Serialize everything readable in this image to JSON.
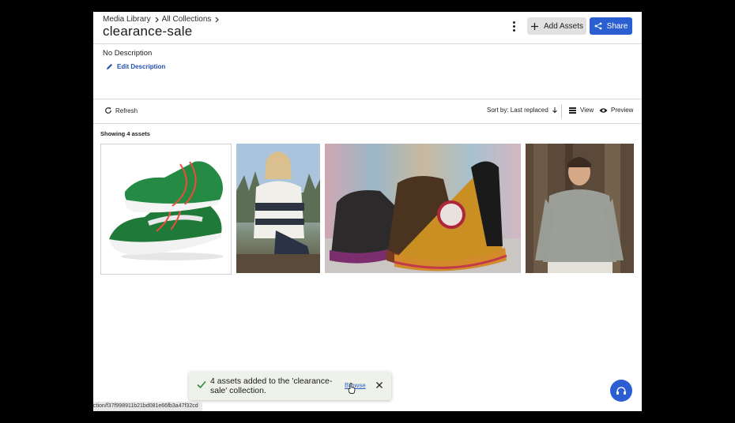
{
  "breadcrumb": [
    {
      "label": "Media Library"
    },
    {
      "label": "All Collections"
    }
  ],
  "collection": {
    "title": "clearance-sale",
    "description": "No Description",
    "edit_description_label": "Edit Description"
  },
  "header": {
    "more_icon": "more-vertical-icon",
    "add_assets_label": "Add Assets",
    "share_label": "Share"
  },
  "toolbar": {
    "refresh_label": "Refresh",
    "sort_label": "Sort by: Last replaced",
    "view_label": "View",
    "preview_label": "Preview"
  },
  "assets": {
    "showing_label": "Showing 4 assets",
    "items": [
      {
        "kind": "sneaker"
      },
      {
        "kind": "sweater-woman"
      },
      {
        "kind": "boots"
      },
      {
        "kind": "sweater-man"
      }
    ]
  },
  "toast": {
    "message": "4 assets added to the 'clearance-sale' collection.",
    "link_label": "Browse"
  },
  "status_bar": {
    "url": "ction/f37f998911b21bd081e66fb3a47f32cd"
  },
  "colors": {
    "accent": "#2b5fd1",
    "toast_bg": "#eef2e9",
    "toast_check": "#2e8b3e"
  }
}
